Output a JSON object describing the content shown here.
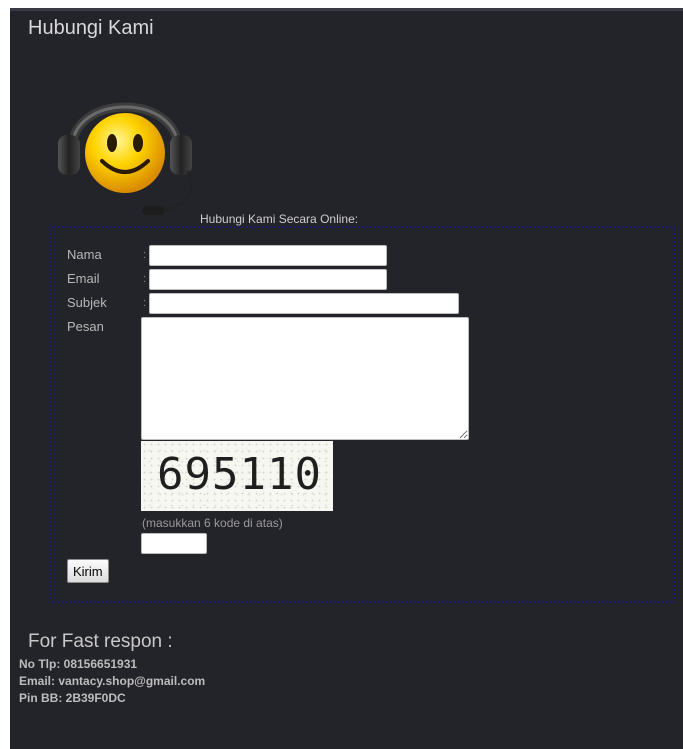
{
  "page": {
    "title": "Hubungi Kami"
  },
  "form": {
    "caption": "Hubungi Kami Secara Online:",
    "fields": {
      "nama": {
        "label": "Nama",
        "value": ""
      },
      "email": {
        "label": "Email",
        "value": ""
      },
      "subjek": {
        "label": "Subjek",
        "value": ""
      },
      "pesan": {
        "label": "Pesan",
        "value": ""
      }
    },
    "colon": ":",
    "captcha": {
      "code": "695110",
      "hint": "(masukkan 6 kode di atas)",
      "value": ""
    },
    "submit_label": "Kirim"
  },
  "contact": {
    "title": "For Fast respon :",
    "phone": "No Tlp: 08156651931",
    "email": "Email: vantacy.shop@gmail.com",
    "pin": "Pin BB: 2B39F0DC"
  },
  "icons": {
    "mascot": "smiley-headset-icon"
  },
  "colors": {
    "background": "#23232a",
    "form_border": "#1c1c6a",
    "text": "#d8d8d8"
  }
}
